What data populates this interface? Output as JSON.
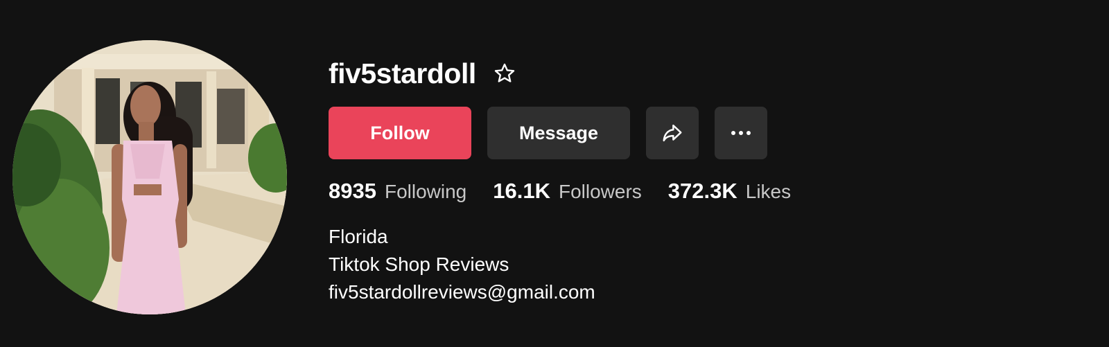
{
  "profile": {
    "username": "fiv5stardoll",
    "avatar_alt": "profile photo",
    "star_icon": "star-outline-icon"
  },
  "actions": {
    "follow_label": "Follow",
    "message_label": "Message",
    "share_icon": "share-arrow-icon",
    "more_icon": "more-dots-icon"
  },
  "stats": [
    {
      "value": "8935",
      "label": "Following"
    },
    {
      "value": "16.1K",
      "label": "Followers"
    },
    {
      "value": "372.3K",
      "label": "Likes"
    }
  ],
  "bio": {
    "lines": [
      "Florida",
      "Tiktok Shop Reviews",
      "fiv5stardollreviews@gmail.com"
    ]
  },
  "colors": {
    "background": "#121212",
    "follow_button": "#ea445a",
    "secondary_button": "#2f2f2f",
    "stat_label": "#c8c8c8"
  }
}
